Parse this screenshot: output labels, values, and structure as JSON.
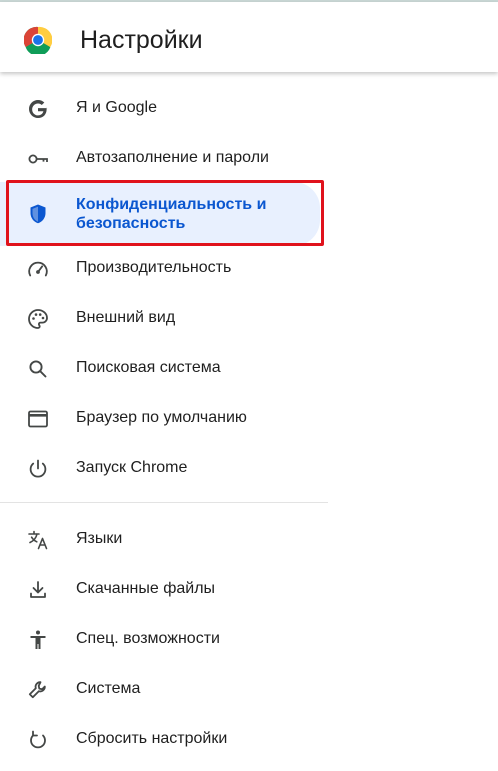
{
  "header": {
    "title": "Настройки",
    "logo_icon": "chrome-logo-icon"
  },
  "colors": {
    "accent": "#0b57d0",
    "active_bg": "#e8f0fe",
    "highlight_border": "#e0121c",
    "text": "#1f1f1f",
    "icon": "#444746"
  },
  "menu": {
    "items": [
      {
        "label": "Я и Google",
        "icon": "google-g-icon"
      },
      {
        "label": "Автозаполнение и пароли",
        "icon": "key-icon"
      },
      {
        "label": "Конфиденциальность и безопасность",
        "icon": "shield-icon",
        "active": true
      },
      {
        "label": "Производительность",
        "icon": "speedometer-icon"
      },
      {
        "label": "Внешний вид",
        "icon": "palette-icon"
      },
      {
        "label": "Поисковая система",
        "icon": "search-icon"
      },
      {
        "label": "Браузер по умолчанию",
        "icon": "browser-window-icon"
      },
      {
        "label": "Запуск Chrome",
        "icon": "power-icon"
      },
      {
        "label": "Языки",
        "icon": "translate-icon"
      },
      {
        "label": "Скачанные файлы",
        "icon": "download-icon"
      },
      {
        "label": "Спец. возможности",
        "icon": "accessibility-icon"
      },
      {
        "label": "Система",
        "icon": "wrench-icon"
      },
      {
        "label": "Сбросить настройки",
        "icon": "reset-icon"
      }
    ]
  }
}
